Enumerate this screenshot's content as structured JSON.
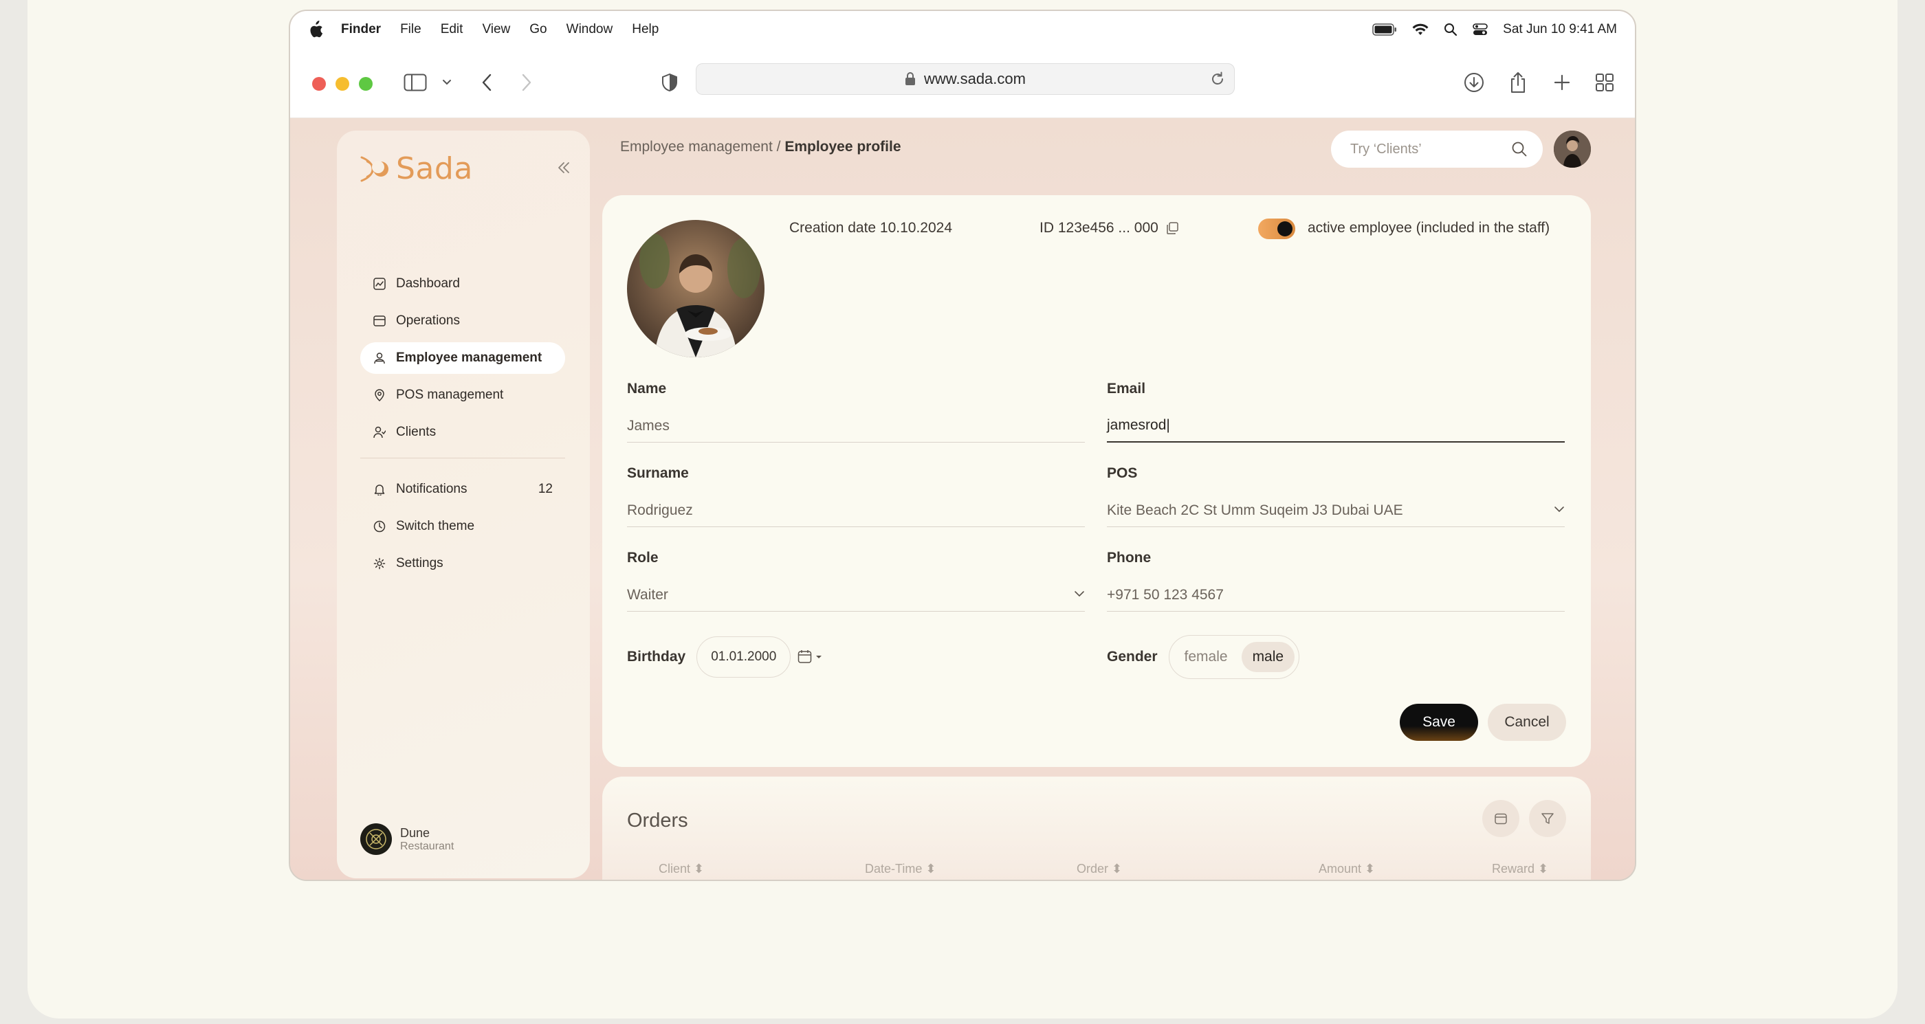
{
  "menubar": {
    "app": "Finder",
    "items": [
      "File",
      "Edit",
      "View",
      "Go",
      "Window",
      "Help"
    ],
    "datetime": "Sat Jun 10  9:41 AM"
  },
  "browser": {
    "url": "www.sada.com"
  },
  "brand": {
    "name": "Sada",
    "accent": "#e39b58"
  },
  "sidebar": {
    "items": [
      {
        "label": "Dashboard",
        "icon": "chart-icon"
      },
      {
        "label": "Operations",
        "icon": "wallet-icon"
      },
      {
        "label": "Employee management",
        "icon": "employee-icon",
        "active": true
      },
      {
        "label": "POS management",
        "icon": "location-pin-icon"
      },
      {
        "label": "Clients",
        "icon": "users-icon"
      }
    ],
    "secondary": [
      {
        "label": "Notifications",
        "icon": "bell-icon",
        "count": "12"
      },
      {
        "label": "Switch theme",
        "icon": "theme-icon"
      },
      {
        "label": "Settings",
        "icon": "gear-icon"
      }
    ],
    "user": {
      "name": "Dune",
      "subtitle": "Restaurant"
    }
  },
  "header": {
    "breadcrumb_parent": "Employee management /",
    "breadcrumb_current": "Employee profile",
    "search_placeholder": "Try ‘Clients’"
  },
  "profile": {
    "creation_date": "Creation date 10.10.2024",
    "id": "ID 123e456 ... 000",
    "active_toggle_label": "active employee (included in the staff)",
    "active": true,
    "fields": {
      "name": {
        "label": "Name",
        "value": "James"
      },
      "email": {
        "label": "Email",
        "value": "jamesrod|"
      },
      "surname": {
        "label": "Surname",
        "value": "Rodriguez"
      },
      "pos": {
        "label": "POS",
        "value": "Kite Beach 2C St Umm Suqeim J3 Dubai UAE"
      },
      "role": {
        "label": "Role",
        "value": "Waiter"
      },
      "phone": {
        "label": "Phone",
        "value": "+971 50 123 4567"
      }
    },
    "birthday": {
      "label": "Birthday",
      "value": "01.01.2000"
    },
    "gender": {
      "label": "Gender",
      "options": [
        "female",
        "male"
      ],
      "selected": "male"
    },
    "save_label": "Save",
    "cancel_label": "Cancel"
  },
  "orders": {
    "title": "Orders",
    "columns": [
      "Client",
      "Date-Time",
      "Order",
      "Amount",
      "Reward"
    ]
  }
}
